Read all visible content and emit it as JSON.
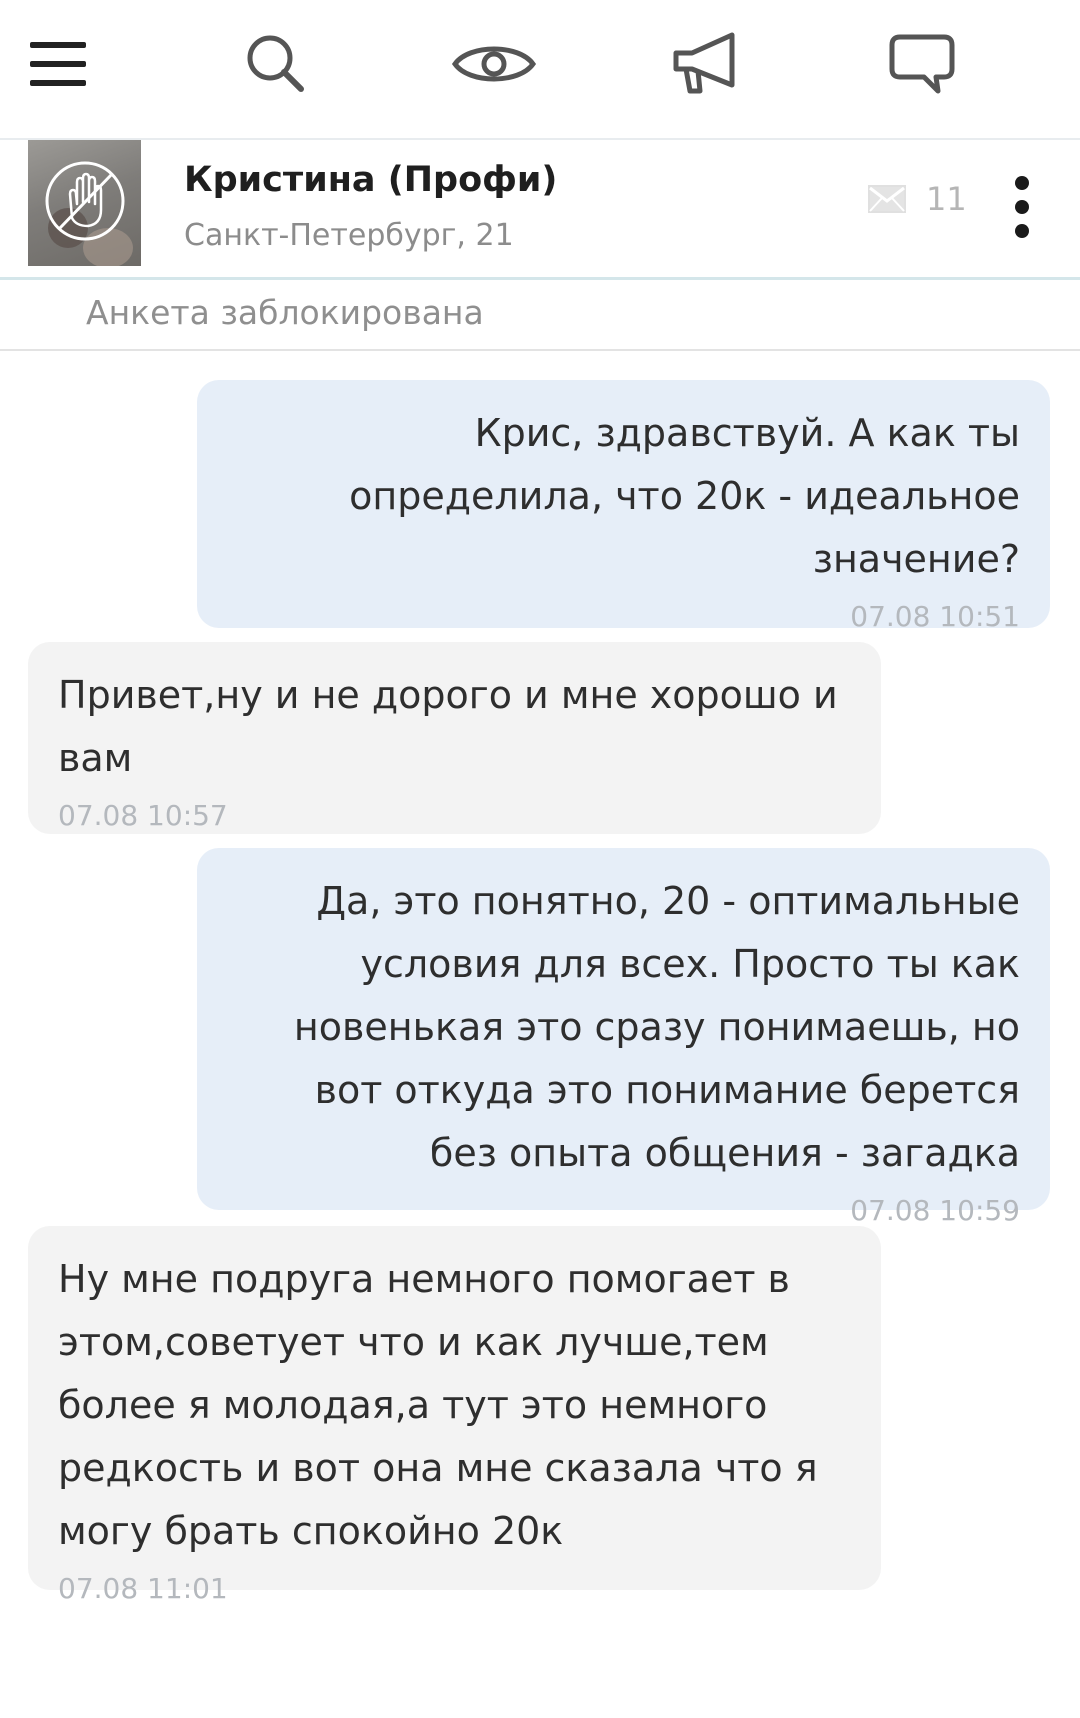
{
  "topbar": {
    "icons": [
      "menu-icon",
      "search-icon",
      "eye-icon",
      "megaphone-icon",
      "chat-icon"
    ]
  },
  "contact": {
    "name": "Кристина (Профи)",
    "meta": "Санкт-Петербург, 21",
    "message_count": "11"
  },
  "banner": {
    "text": "Анкета заблокирована"
  },
  "messages": [
    {
      "direction": "outgoing",
      "text": "Крис, здравствуй. А как ты определила, что 20к - идеальное значение?",
      "time": "07.08 10:51"
    },
    {
      "direction": "incoming",
      "text": "Привет,ну и не дорого и мне хорошо и вам",
      "time": "07.08 10:57"
    },
    {
      "direction": "outgoing",
      "text": "Да, это понятно, 20 - оптимальные условия для всех. Просто ты как новенькая это сразу понимаешь, но вот откуда это понимание берется без опыта общения - загадка",
      "time": "07.08 10:59"
    },
    {
      "direction": "incoming",
      "text": "Ну мне подруга немного помогает в этом,советует что и как лучше,тем более я молодая,а тут это немного редкость и вот она мне сказала что я могу брать спокойно 20к",
      "time": "07.08 11:01"
    }
  ],
  "colors": {
    "outgoing_bubble": "#e6eef8",
    "incoming_bubble": "#f3f3f3",
    "timestamp": "#b4b8bd",
    "header_divider": "#d4e6ea"
  }
}
